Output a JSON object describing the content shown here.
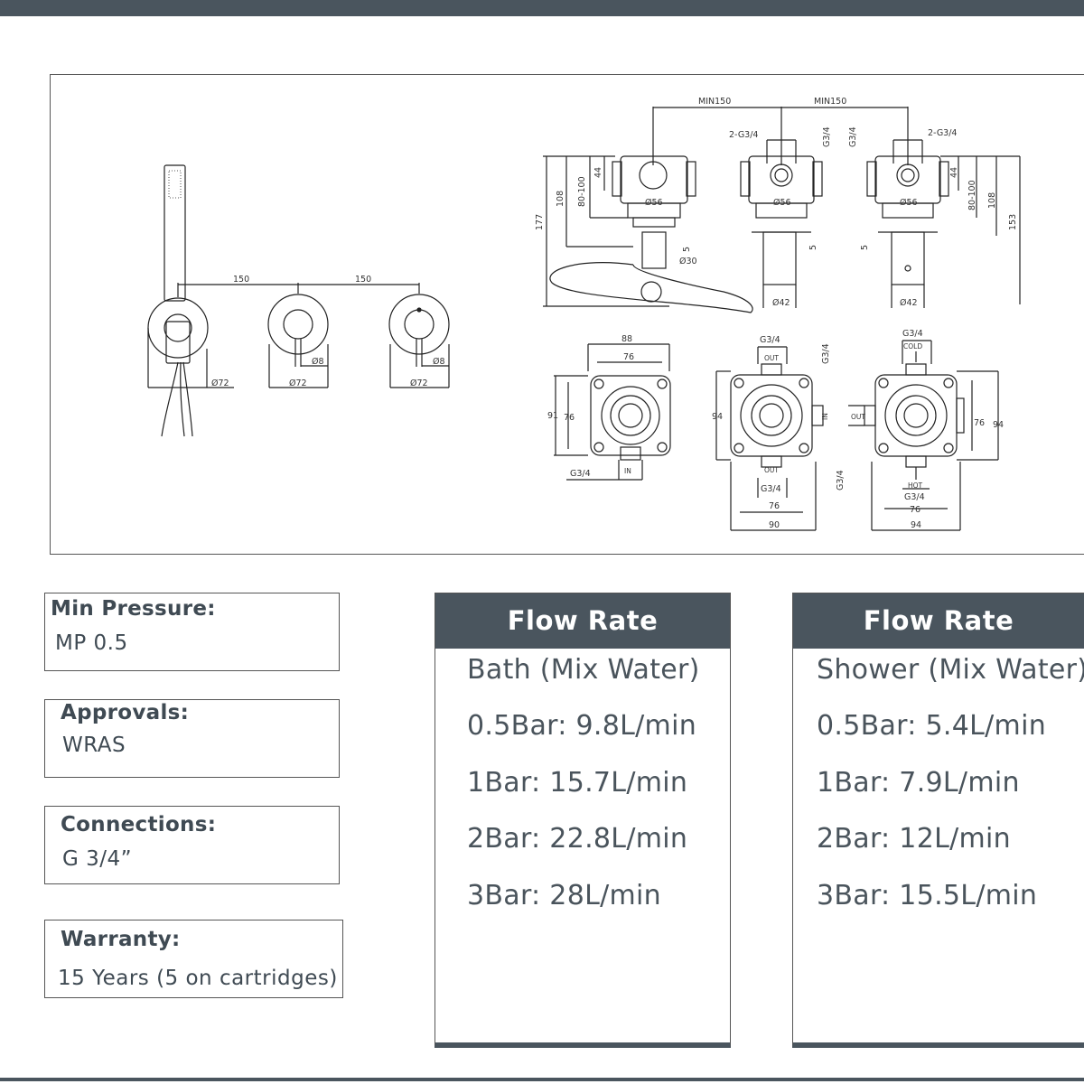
{
  "drawing": {
    "front_view": {
      "dim_spacing_1": "150",
      "dim_spacing_2": "150",
      "dia_rose_1": "Ø72",
      "dia_rose_2": "Ø72",
      "dia_rose_3": "Ø72",
      "dia_lever_1": "Ø8",
      "dia_lever_2": "Ø8"
    },
    "side_view": {
      "min_spacing_1": "MIN150",
      "min_spacing_2": "MIN150",
      "thread_1": "2-G3/4",
      "thread_2": "G3/4",
      "thread_3": "G3/4",
      "thread_4": "2-G3/4",
      "dia_56_1": "Ø56",
      "dia_56_2": "Ø56",
      "dia_56_3": "Ø56",
      "h_44_1": "44",
      "h_44_2": "44",
      "h_range_1": "80-100",
      "h_range_2": "80-100",
      "h_108_1": "108",
      "h_108_2": "108",
      "h_177": "177",
      "h_153": "153",
      "gap_5_1": "5",
      "gap_5_2": "5",
      "gap_5_3": "5",
      "dia_30": "Ø30",
      "dia_42_1": "Ø42",
      "dia_42_2": "Ø42"
    },
    "rear_view": {
      "w_88": "88",
      "w_76_1": "76",
      "h_91": "91",
      "h_76_1": "76",
      "thread_in_1": "G3/4",
      "in_1": "IN",
      "thread_out_top": "G3/4",
      "out_top": "OUT",
      "thread_side": "G3/4",
      "in_side": "IN",
      "h_94_1": "94",
      "out_bottom": "OUT",
      "thread_out_bottom": "G3/4",
      "w_76_2": "76",
      "w_90": "90",
      "thread_cold": "G3/4",
      "cold": "COLD",
      "out_left": "OUT",
      "thread_left": "G3/4",
      "h_76_2": "76",
      "h_94_2": "94",
      "hot": "HOT",
      "thread_hot": "G3/4",
      "w_76_3": "76",
      "w_94": "94"
    }
  },
  "specs": [
    {
      "label": "Min Pressure:",
      "value": "MP 0.5"
    },
    {
      "label": "Approvals:",
      "value": "WRAS"
    },
    {
      "label": "Connections:",
      "value": "G 3/4”"
    },
    {
      "label": "Warranty:",
      "value": "15 Years (5 on cartridges)"
    }
  ],
  "flow_bath": {
    "header": "Flow Rate",
    "rows": [
      "Bath (Mix Water)",
      "0.5Bar: 9.8L/min",
      "1Bar: 15.7L/min",
      "2Bar: 22.8L/min",
      "3Bar: 28L/min"
    ]
  },
  "flow_shower": {
    "header": "Flow Rate",
    "rows": [
      "Shower (Mix Water)",
      "0.5Bar: 5.4L/min",
      "1Bar: 7.9L/min",
      "2Bar: 12L/min",
      "3Bar: 15.5L/min"
    ]
  }
}
